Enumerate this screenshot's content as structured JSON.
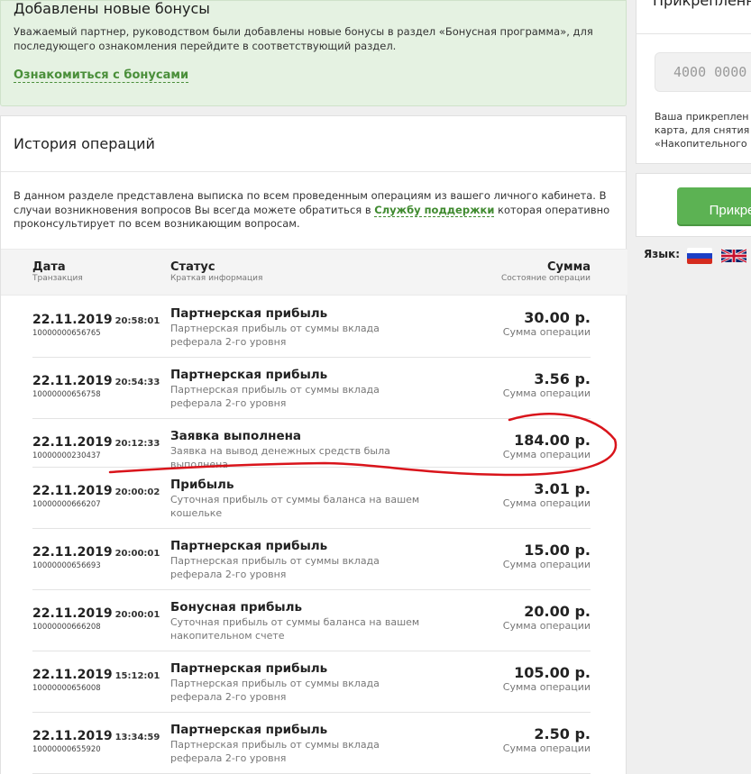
{
  "notice": {
    "title": "Добавлены новые бонусы",
    "text": "Уважаемый партнер, руководством были добавлены новые бонусы в раздел «Бонусная программа», для последующего ознакомления перейдите в соответствующий раздел.",
    "link": "Ознакомиться с бонусами"
  },
  "history": {
    "title": "История операций",
    "desc_before": "В данном разделе представлена выписка по всем проведенным операциям из вашего личного кабинета. В случаи возникновения вопросов Вы всегда можете обратиться в",
    "support_link": "Службу поддержки",
    "desc_after": "которая оперативно проконсультирует по всем возникающим вопросам.",
    "columns": {
      "date": "Дата",
      "date_sub": "Транзакция",
      "status": "Статус",
      "status_sub": "Краткая информация",
      "sum": "Сумма",
      "sum_sub": "Состояние операции"
    },
    "rows": [
      {
        "date": "22.11.2019",
        "time": "20:58:01",
        "id": "10000000656765",
        "title": "Партнерская прибыль",
        "info": "Партнерская прибыль от суммы вклада реферала 2-го уровня",
        "amount": "30.00 р.",
        "amount_sub": "Сумма операции"
      },
      {
        "date": "22.11.2019",
        "time": "20:54:33",
        "id": "10000000656758",
        "title": "Партнерская прибыль",
        "info": "Партнерская прибыль от суммы вклада реферала 2-го уровня",
        "amount": "3.56 р.",
        "amount_sub": "Сумма операции"
      },
      {
        "date": "22.11.2019",
        "time": "20:12:33",
        "id": "10000000230437",
        "title": "Заявка выполнена",
        "info": "Заявка на вывод денежных средств была выполнена",
        "amount": "184.00 р.",
        "amount_sub": "Сумма операции"
      },
      {
        "date": "22.11.2019",
        "time": "20:00:02",
        "id": "10000000666207",
        "title": "Прибыль",
        "info": "Суточная прибыль от суммы баланса на вашем кошельке",
        "amount": "3.01 р.",
        "amount_sub": "Сумма операции"
      },
      {
        "date": "22.11.2019",
        "time": "20:00:01",
        "id": "10000000656693",
        "title": "Партнерская прибыль",
        "info": "Партнерская прибыль от суммы вклада реферала 2-го уровня",
        "amount": "15.00 р.",
        "amount_sub": "Сумма операции"
      },
      {
        "date": "22.11.2019",
        "time": "20:00:01",
        "id": "10000000666208",
        "title": "Бонусная прибыль",
        "info": "Суточная прибыль от суммы баланса на вашем накопительном счете",
        "amount": "20.00 р.",
        "amount_sub": "Сумма операции"
      },
      {
        "date": "22.11.2019",
        "time": "15:12:01",
        "id": "10000000656008",
        "title": "Партнерская прибыль",
        "info": "Партнерская прибыль от суммы вклада реферала 2-го уровня",
        "amount": "105.00 р.",
        "amount_sub": "Сумма операции"
      },
      {
        "date": "22.11.2019",
        "time": "13:34:59",
        "id": "10000000655920",
        "title": "Партнерская прибыль",
        "info": "Партнерская прибыль от суммы вклада реферала 2-го уровня",
        "amount": "2.50 р.",
        "amount_sub": "Сумма операции"
      }
    ]
  },
  "card": {
    "title": "Прикрепленн",
    "placeholder": "4000 0000",
    "desc_lines": [
      "Ваша прикреплен",
      "карта, для снятия",
      "«Накопительного"
    ]
  },
  "attach_button": "Прикре",
  "language": {
    "label": "Язык:",
    "flags": [
      "russian-flag-icon",
      "uk-flag-icon"
    ]
  },
  "colors": {
    "accent_green": "#5cb253",
    "link_green": "#3f8a2f",
    "notice_bg": "#e5f2e2",
    "annotation_red": "#d9141b"
  }
}
